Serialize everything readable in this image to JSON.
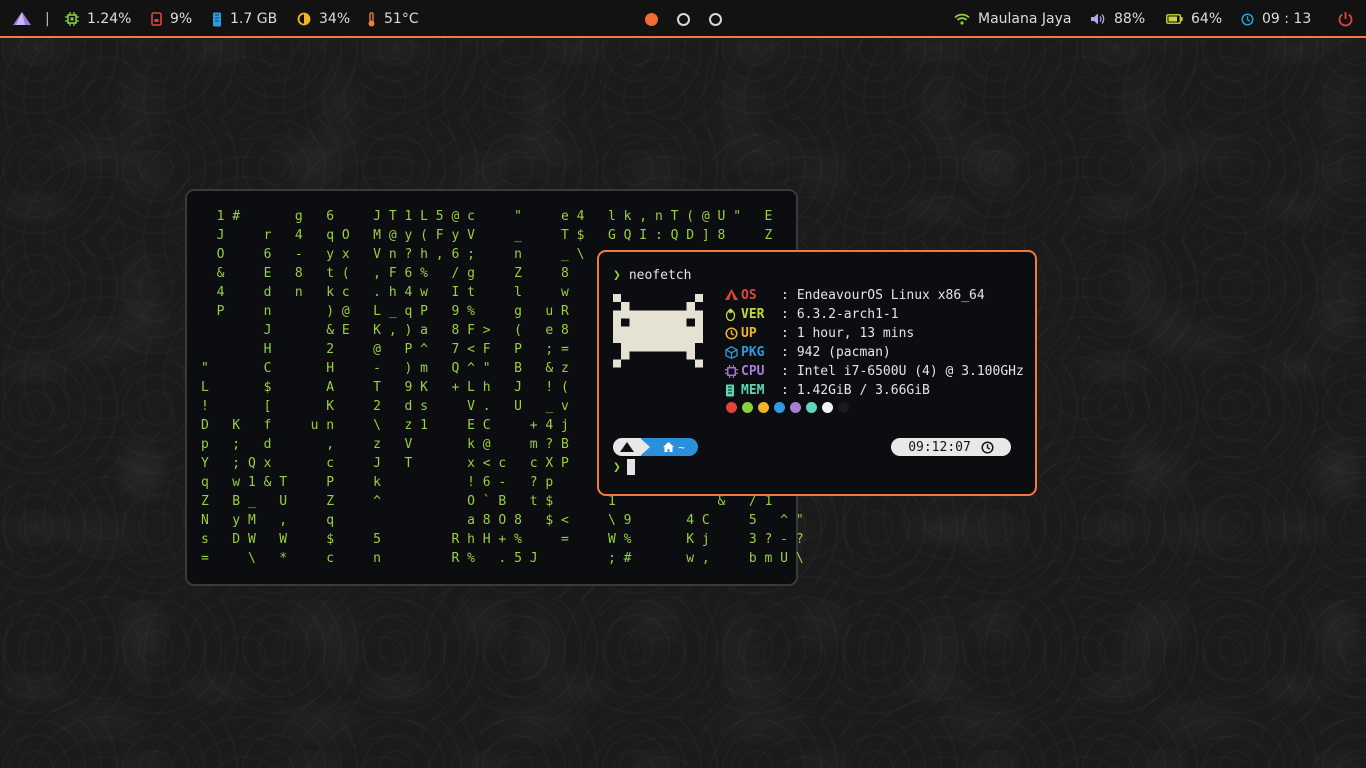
{
  "topbar": {
    "separator": "|",
    "cpu": "1.24%",
    "disk": "9%",
    "ram": "1.7 GB",
    "brightness": "34%",
    "temp": "51°C",
    "wifi": "Maulana Jaya",
    "volume": "88%",
    "battery": "64%",
    "clock": "09 : 13",
    "workspaces": [
      {
        "active": true
      },
      {
        "active": false
      },
      {
        "active": false
      }
    ],
    "icons": [
      "endeavour-logo-icon",
      "cpu-icon",
      "disk-icon",
      "memory-icon",
      "brightness-icon",
      "thermometer-icon",
      "wifi-icon",
      "volume-icon",
      "battery-icon",
      "clock-icon",
      "power-icon"
    ],
    "colors": {
      "accent": "#f07b3f",
      "power": "#e0453a"
    }
  },
  "matrix": {
    "lines": [
      "  1 #       g   6     J T 1 L 5 @ c     \"     e 4   l k , n T ( @ U \"   E",
      "  J     r   4   q O   M @ y ( F y V     _     T $   G Q I : Q D ] 8     Z",
      "  O     6   -   y x   V n ? h , 6 ;     n     _ \\",
      "  &     E   8   t (   , F 6 %   / g     Z     8",
      "  4     d   n   k c   . h 4 w   I t     l     w",
      "  P     n       ) @   L _ q P   9 %     g   u R",
      "        J       & E   K , ) a   8 F >   (   e 8",
      "        H       2     @   P ^   7 < F   P   ; =",
      "\"       C       H     -   ) m   Q ^ \"   B   & z",
      "L       $       A     T   9 K   + L h   J   ! (",
      "!       [       K     2   d s     V .   U   _ v",
      "D   K   f     u n     \\   z 1     E C     + 4 j",
      "p   ;   d       ,     z   V       k @     m ? B",
      "Y   ; Q x       c     J   T       x < c   c X P",
      "q   w 1 & T     P     k           ! 6 -   ? p",
      "Z   B _   U     Z     ^           O ` B   t $       1             &   / 1",
      "N   y M   ,     q                 a 8 O 8   $ <     \\ 9       4 C     5   ^ \"",
      "s   D W   W     $     5         R h H + %     =     W %       K j     3 ? - ?",
      "=     \\   *     c     n         R %   . 5 J         ; #       w ,     b m U \\"
    ]
  },
  "neofetch": {
    "command": "neofetch",
    "prompt_symbol": "❯",
    "rows": [
      {
        "key": "OS",
        "value": "EndeavourOS Linux x86_64",
        "color": "#e0453a",
        "icon": "endeavour-logo-icon"
      },
      {
        "key": "VER",
        "value": "6.3.2-arch1-1",
        "color": "#c9d63a",
        "icon": "tux-icon"
      },
      {
        "key": "UP",
        "value": "1 hour, 13 mins",
        "color": "#f0b429",
        "icon": "uptime-clock-icon"
      },
      {
        "key": "PKG",
        "value": "942 (pacman)",
        "color": "#2e9be0",
        "icon": "package-icon"
      },
      {
        "key": "CPU",
        "value": "Intel i7-6500U (4) @ 3.100GHz",
        "color": "#a77ed6",
        "icon": "cpu-icon"
      },
      {
        "key": "MEM",
        "value": "1.42GiB / 3.66GiB",
        "color": "#5fd6b8",
        "icon": "memory-icon"
      }
    ],
    "palette": [
      "#e0453a",
      "#8ccf3f",
      "#f0b429",
      "#2e9be0",
      "#a77ed6",
      "#5fd6b8",
      "#f2f2f2",
      "#1a1a1a"
    ],
    "path": "~",
    "time": "09:12:07"
  }
}
